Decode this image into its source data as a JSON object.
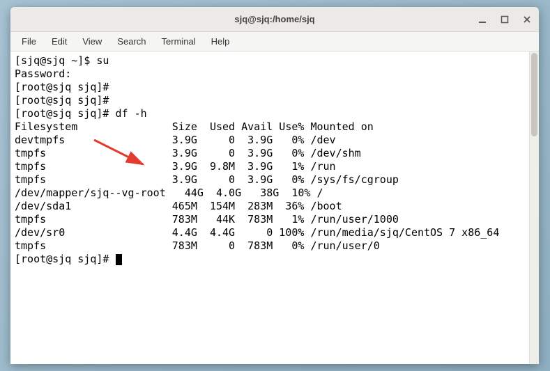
{
  "titlebar": {
    "title": "sjq@sjq:/home/sjq"
  },
  "menubar": {
    "file": "File",
    "edit": "Edit",
    "view": "View",
    "search": "Search",
    "terminal": "Terminal",
    "help": "Help"
  },
  "session": {
    "line1": "[sjq@sjq ~]$ su",
    "line2": "Password:",
    "line3": "[root@sjq sjq]#",
    "line4": "[root@sjq sjq]#",
    "line5": "[root@sjq sjq]# df -h",
    "header": "Filesystem               Size  Used Avail Use% Mounted on",
    "rows": [
      "devtmpfs                 3.9G     0  3.9G   0% /dev",
      "tmpfs                    3.9G     0  3.9G   0% /dev/shm",
      "tmpfs                    3.9G  9.8M  3.9G   1% /run",
      "tmpfs                    3.9G     0  3.9G   0% /sys/fs/cgroup",
      "/dev/mapper/sjq--vg-root   44G  4.0G   38G  10% /",
      "/dev/sda1                465M  154M  283M  36% /boot",
      "tmpfs                    783M   44K  783M   1% /run/user/1000",
      "/dev/sr0                 4.4G  4.4G     0 100% /run/media/sjq/CentOS 7 x86_64",
      "tmpfs                    783M     0  783M   0% /run/user/0"
    ],
    "prompt_final": "[root@sjq sjq]# "
  }
}
